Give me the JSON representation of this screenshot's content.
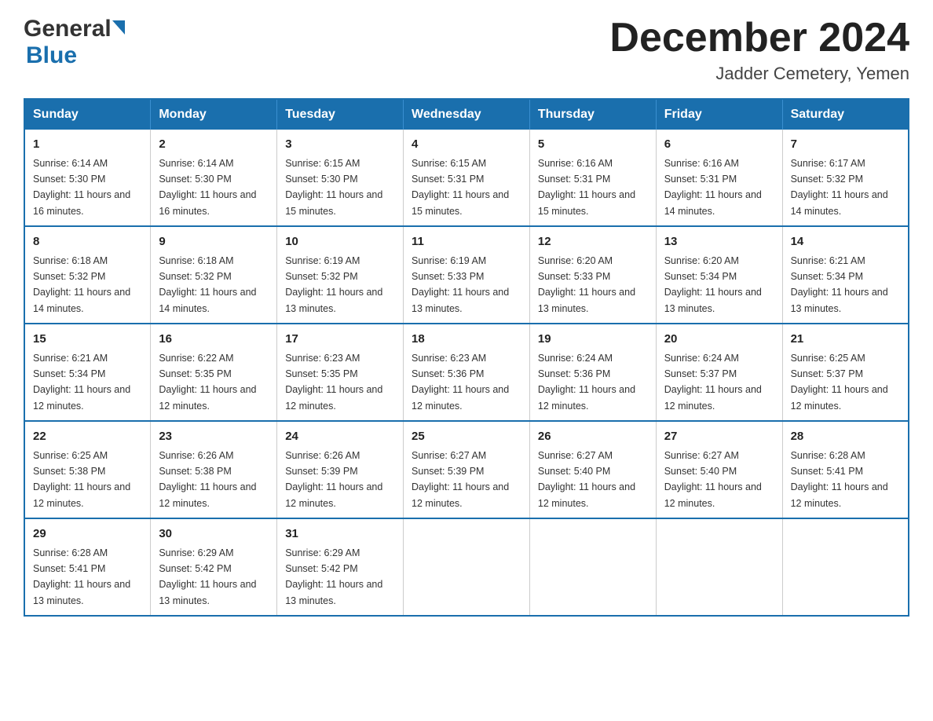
{
  "header": {
    "logo_general": "General",
    "logo_blue": "Blue",
    "title": "December 2024",
    "location": "Jadder Cemetery, Yemen"
  },
  "calendar": {
    "days_of_week": [
      "Sunday",
      "Monday",
      "Tuesday",
      "Wednesday",
      "Thursday",
      "Friday",
      "Saturday"
    ],
    "weeks": [
      [
        {
          "day": "1",
          "sunrise": "6:14 AM",
          "sunset": "5:30 PM",
          "daylight": "11 hours and 16 minutes."
        },
        {
          "day": "2",
          "sunrise": "6:14 AM",
          "sunset": "5:30 PM",
          "daylight": "11 hours and 16 minutes."
        },
        {
          "day": "3",
          "sunrise": "6:15 AM",
          "sunset": "5:30 PM",
          "daylight": "11 hours and 15 minutes."
        },
        {
          "day": "4",
          "sunrise": "6:15 AM",
          "sunset": "5:31 PM",
          "daylight": "11 hours and 15 minutes."
        },
        {
          "day": "5",
          "sunrise": "6:16 AM",
          "sunset": "5:31 PM",
          "daylight": "11 hours and 15 minutes."
        },
        {
          "day": "6",
          "sunrise": "6:16 AM",
          "sunset": "5:31 PM",
          "daylight": "11 hours and 14 minutes."
        },
        {
          "day": "7",
          "sunrise": "6:17 AM",
          "sunset": "5:32 PM",
          "daylight": "11 hours and 14 minutes."
        }
      ],
      [
        {
          "day": "8",
          "sunrise": "6:18 AM",
          "sunset": "5:32 PM",
          "daylight": "11 hours and 14 minutes."
        },
        {
          "day": "9",
          "sunrise": "6:18 AM",
          "sunset": "5:32 PM",
          "daylight": "11 hours and 14 minutes."
        },
        {
          "day": "10",
          "sunrise": "6:19 AM",
          "sunset": "5:32 PM",
          "daylight": "11 hours and 13 minutes."
        },
        {
          "day": "11",
          "sunrise": "6:19 AM",
          "sunset": "5:33 PM",
          "daylight": "11 hours and 13 minutes."
        },
        {
          "day": "12",
          "sunrise": "6:20 AM",
          "sunset": "5:33 PM",
          "daylight": "11 hours and 13 minutes."
        },
        {
          "day": "13",
          "sunrise": "6:20 AM",
          "sunset": "5:34 PM",
          "daylight": "11 hours and 13 minutes."
        },
        {
          "day": "14",
          "sunrise": "6:21 AM",
          "sunset": "5:34 PM",
          "daylight": "11 hours and 13 minutes."
        }
      ],
      [
        {
          "day": "15",
          "sunrise": "6:21 AM",
          "sunset": "5:34 PM",
          "daylight": "11 hours and 12 minutes."
        },
        {
          "day": "16",
          "sunrise": "6:22 AM",
          "sunset": "5:35 PM",
          "daylight": "11 hours and 12 minutes."
        },
        {
          "day": "17",
          "sunrise": "6:23 AM",
          "sunset": "5:35 PM",
          "daylight": "11 hours and 12 minutes."
        },
        {
          "day": "18",
          "sunrise": "6:23 AM",
          "sunset": "5:36 PM",
          "daylight": "11 hours and 12 minutes."
        },
        {
          "day": "19",
          "sunrise": "6:24 AM",
          "sunset": "5:36 PM",
          "daylight": "11 hours and 12 minutes."
        },
        {
          "day": "20",
          "sunrise": "6:24 AM",
          "sunset": "5:37 PM",
          "daylight": "11 hours and 12 minutes."
        },
        {
          "day": "21",
          "sunrise": "6:25 AM",
          "sunset": "5:37 PM",
          "daylight": "11 hours and 12 minutes."
        }
      ],
      [
        {
          "day": "22",
          "sunrise": "6:25 AM",
          "sunset": "5:38 PM",
          "daylight": "11 hours and 12 minutes."
        },
        {
          "day": "23",
          "sunrise": "6:26 AM",
          "sunset": "5:38 PM",
          "daylight": "11 hours and 12 minutes."
        },
        {
          "day": "24",
          "sunrise": "6:26 AM",
          "sunset": "5:39 PM",
          "daylight": "11 hours and 12 minutes."
        },
        {
          "day": "25",
          "sunrise": "6:27 AM",
          "sunset": "5:39 PM",
          "daylight": "11 hours and 12 minutes."
        },
        {
          "day": "26",
          "sunrise": "6:27 AM",
          "sunset": "5:40 PM",
          "daylight": "11 hours and 12 minutes."
        },
        {
          "day": "27",
          "sunrise": "6:27 AM",
          "sunset": "5:40 PM",
          "daylight": "11 hours and 12 minutes."
        },
        {
          "day": "28",
          "sunrise": "6:28 AM",
          "sunset": "5:41 PM",
          "daylight": "11 hours and 12 minutes."
        }
      ],
      [
        {
          "day": "29",
          "sunrise": "6:28 AM",
          "sunset": "5:41 PM",
          "daylight": "11 hours and 13 minutes."
        },
        {
          "day": "30",
          "sunrise": "6:29 AM",
          "sunset": "5:42 PM",
          "daylight": "11 hours and 13 minutes."
        },
        {
          "day": "31",
          "sunrise": "6:29 AM",
          "sunset": "5:42 PM",
          "daylight": "11 hours and 13 minutes."
        },
        null,
        null,
        null,
        null
      ]
    ]
  }
}
